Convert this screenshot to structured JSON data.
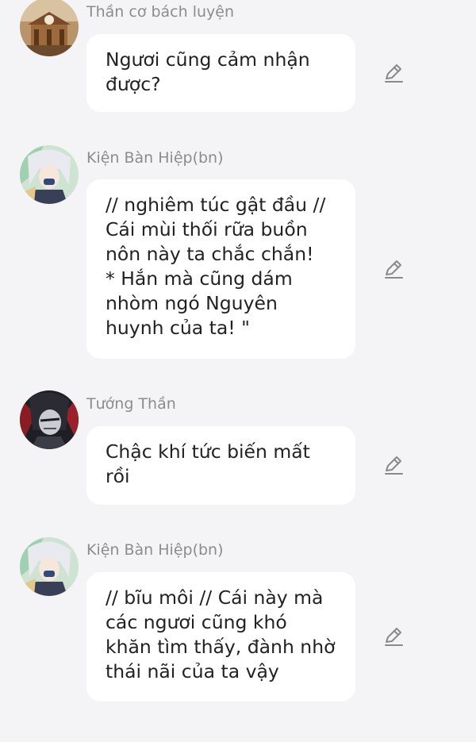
{
  "messages": [
    {
      "sender": "Thần cơ bách luyện",
      "text": "Ngươi cũng cảm nhận\nđược?",
      "avatar_icon": "temple-avatar-icon",
      "edit_icon": "pencil-icon"
    },
    {
      "sender": "Kiện Bàn Hiệp(bn)",
      "text": "// nghiêm túc gật đầu //\nCái mùi thối rữa buồn\nnôn này ta chắc chắn!\n* Hắn mà cũng dám\nnhòm ngó Nguyên\nhuynh của ta! \"",
      "avatar_icon": "white-haired-character-avatar-icon",
      "edit_icon": "pencil-icon"
    },
    {
      "sender": "Tướng Thần",
      "text": "Chậc khí tức biến mất\nrồi",
      "avatar_icon": "dark-haired-character-avatar-icon",
      "edit_icon": "pencil-icon"
    },
    {
      "sender": "Kiện Bàn Hiệp(bn)",
      "text": "// bĩu môi // Cái này mà\ncác ngươi cũng khó\nkhăn tìm thấy, đành nhờ\nthái nãi của ta vậy",
      "avatar_icon": "white-haired-character-avatar-icon",
      "edit_icon": "pencil-icon"
    }
  ],
  "colors": {
    "background": "#f4f4f6",
    "bubble": "#ffffff",
    "sender_text": "#8c8c8c",
    "message_text": "#222222",
    "icon": "#8a8a8a"
  }
}
